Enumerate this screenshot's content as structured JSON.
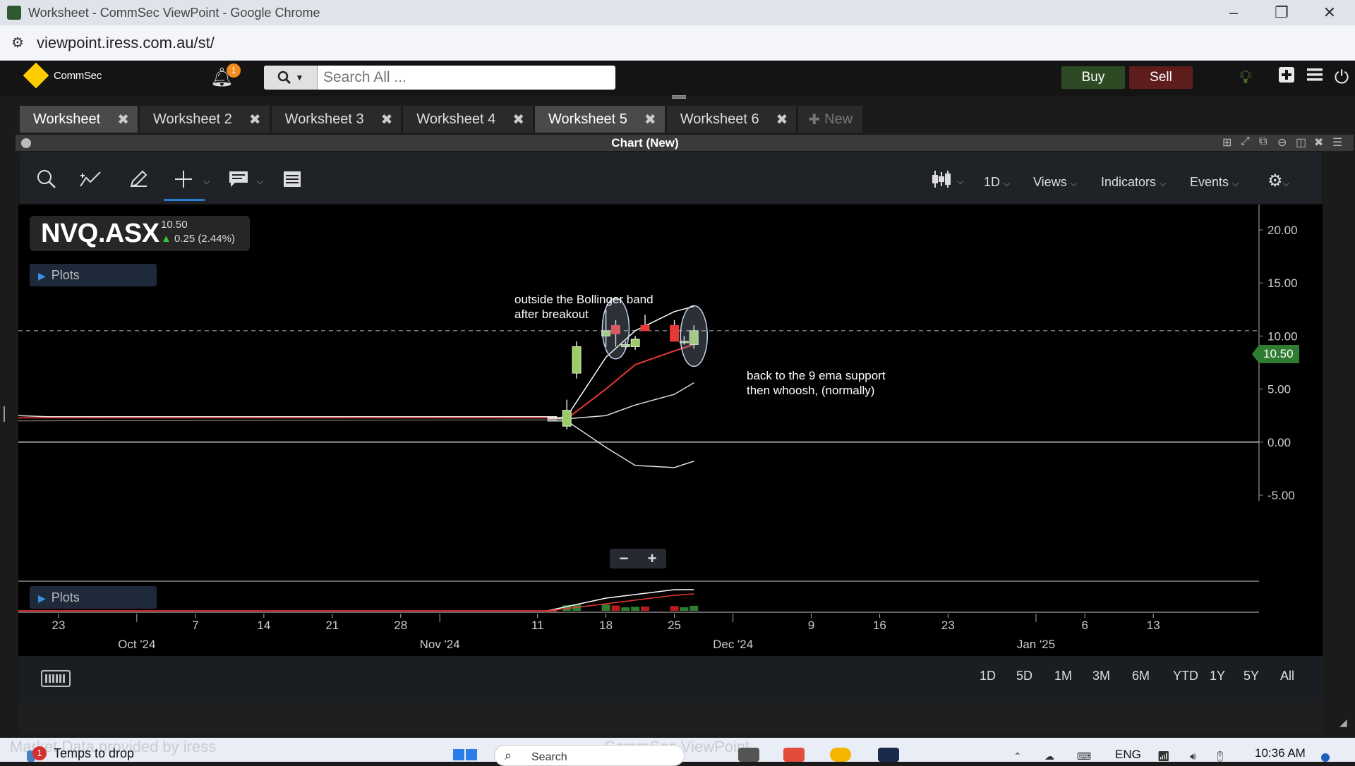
{
  "window": {
    "title": "Worksheet - CommSec ViewPoint - Google Chrome",
    "url": "viewpoint.iress.com.au/st/",
    "minimize": "–",
    "restore": "❐",
    "close": "✕"
  },
  "appbar": {
    "brand": "CommSec",
    "notification_count": "1",
    "search_placeholder": "Search All ...",
    "buy_label": "Buy",
    "sell_label": "Sell"
  },
  "tabs": [
    {
      "label": "Worksheet",
      "active": true
    },
    {
      "label": "Worksheet 2",
      "active": false
    },
    {
      "label": "Worksheet 3",
      "active": false
    },
    {
      "label": "Worksheet 4",
      "active": false
    },
    {
      "label": "Worksheet 5",
      "active": true
    },
    {
      "label": "Worksheet 6",
      "active": false
    }
  ],
  "new_tab_label": "New",
  "panel": {
    "title": "Chart (New)"
  },
  "toolbar": {
    "interval": "1D",
    "views": "Views",
    "indicators": "Indicators",
    "events": "Events"
  },
  "symbol": {
    "code": "NVQ.ASX",
    "last": "10.50",
    "change": "0.25 (2.44%)"
  },
  "plots_label": "Plots",
  "annotations": {
    "a1_line1": "outside the Bollinger band",
    "a1_line2": "after breakout",
    "a2_line1": "back to the 9 ema support",
    "a2_line2": "then whoosh, (normally)"
  },
  "price_tag": "10.50",
  "chart_data": {
    "type": "line",
    "y_ticks": [
      "20.00",
      "15.00",
      "10.00",
      "5.00",
      "0.00",
      "-5.00"
    ],
    "ylim": [
      -5,
      20
    ],
    "x_ticks": [
      "23",
      "7",
      "14",
      "21",
      "28",
      "11",
      "18",
      "25",
      "9",
      "16",
      "23",
      "6",
      "13"
    ],
    "month_labels": [
      "Oct '24",
      "Nov '24",
      "Dec '24",
      "Jan '25"
    ],
    "last_price": 10.5,
    "candles": [
      {
        "date": "2024-11-14",
        "open": 1.5,
        "high": 4.0,
        "low": 1.2,
        "close": 3.0
      },
      {
        "date": "2024-11-15",
        "open": 6.5,
        "high": 9.5,
        "low": 6.0,
        "close": 9.0
      },
      {
        "date": "2024-11-18",
        "open": 10.0,
        "high": 12.5,
        "low": 9.0,
        "close": 10.5
      },
      {
        "date": "2024-11-19",
        "open": 11.0,
        "high": 11.5,
        "low": 9.0,
        "close": 10.2
      },
      {
        "date": "2024-11-20",
        "open": 9.0,
        "high": 9.5,
        "low": 8.8,
        "close": 9.2
      },
      {
        "date": "2024-11-21",
        "open": 9.0,
        "high": 10.0,
        "low": 8.7,
        "close": 9.7
      },
      {
        "date": "2024-11-22",
        "open": 11.0,
        "high": 12.0,
        "low": 10.5,
        "close": 10.5
      },
      {
        "date": "2024-11-25",
        "open": 11.0,
        "high": 11.5,
        "low": 9.5,
        "close": 9.5
      },
      {
        "date": "2024-11-26",
        "open": 9.5,
        "high": 10.0,
        "low": 9.2,
        "close": 9.5
      },
      {
        "date": "2024-11-27",
        "open": 9.2,
        "high": 11.0,
        "low": 8.8,
        "close": 10.5
      }
    ],
    "series": [
      {
        "values": [
          2.3,
          2.3,
          2.4,
          8.0,
          10.5,
          12.3,
          12.8
        ]
      },
      {
        "values": [
          2.2,
          2.2,
          2.2,
          5.0,
          7.3,
          8.6,
          9.2
        ]
      },
      {
        "values": [
          2.2,
          2.2,
          2.2,
          2.5,
          3.5,
          4.5,
          5.6
        ]
      },
      {
        "values": [
          2.0,
          2.0,
          2.0,
          -0.5,
          -2.2,
          -2.4,
          -1.8
        ]
      }
    ],
    "range_buttons": [
      "1D",
      "5D",
      "1M",
      "3M",
      "6M",
      "YTD",
      "1Y",
      "5Y",
      "All"
    ]
  },
  "taskbar": {
    "weather_badge": "1",
    "weather_text": "Temps to drop",
    "search_placeholder": "Search",
    "language": "ENG",
    "time": "10:36 AM",
    "watermark": "Market Data provided by iress",
    "watermark2": "CommSec ViewPoint"
  }
}
